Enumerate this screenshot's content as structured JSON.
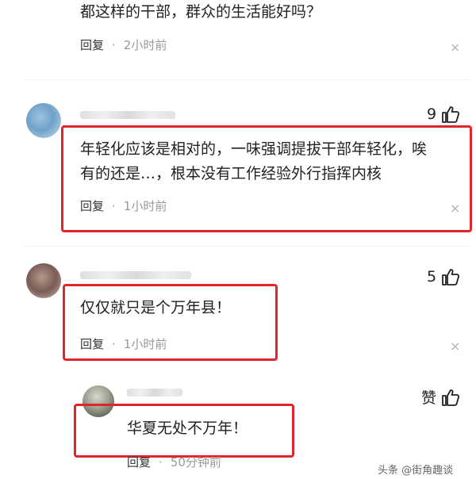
{
  "comments": [
    {
      "text": "都这样的干部，群众的生活能好吗？",
      "reply_label": "回复",
      "dot": "·",
      "time": "2小时前",
      "close": "×"
    },
    {
      "likes": "9",
      "line1": "年轻化应该是相对的，一味强调提拔干部年轻化，唉",
      "line2": "有的还是…，根本没有工作经验外行指挥内核",
      "reply_label": "回复",
      "dot": "·",
      "time": "1小时前",
      "close": "×"
    },
    {
      "likes": "5",
      "text": "仅仅就只是个万年县！",
      "reply_label": "回复",
      "dot": "·",
      "time": "1小时前",
      "close": "×"
    },
    {
      "likes_label": "赞",
      "text": "华夏无处不万年！",
      "reply_label": "回复",
      "dot": "·",
      "time": "50分钟前"
    }
  ],
  "watermark": "头条 @街角趣谈",
  "colors": {
    "highlight_border": "#e0262b",
    "muted": "#999999"
  }
}
